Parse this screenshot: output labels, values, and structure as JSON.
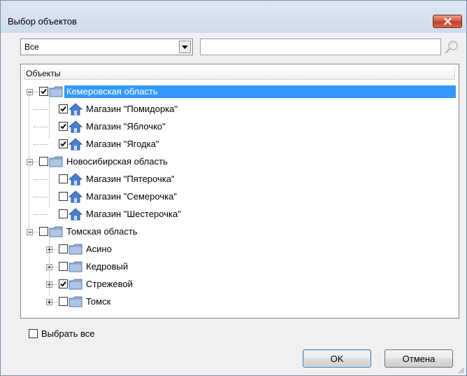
{
  "window": {
    "title": "Выбор объектов"
  },
  "filter": {
    "selected": "Все"
  },
  "search": {
    "value": "",
    "placeholder": ""
  },
  "tree": {
    "column_header": "Объекты",
    "nodes": [
      {
        "label": "Кемеровская область",
        "checked": true,
        "icon": "folder-icon",
        "expanded": true,
        "selected": true,
        "children": [
          {
            "label": "Магазин \"Помидорка\"",
            "checked": true,
            "icon": "house-icon"
          },
          {
            "label": "Магазин \"Яблочко\"",
            "checked": true,
            "icon": "house-icon"
          },
          {
            "label": "Магазин \"Ягодка\"",
            "checked": true,
            "icon": "house-icon"
          }
        ]
      },
      {
        "label": "Новосибирская область",
        "checked": false,
        "icon": "folder-icon",
        "expanded": true,
        "children": [
          {
            "label": "Магазин \"Пятерочка\"",
            "checked": false,
            "icon": "house-icon"
          },
          {
            "label": "Магазин \"Семерочка\"",
            "checked": false,
            "icon": "house-icon"
          },
          {
            "label": "Магазин \"Шестерочка\"",
            "checked": false,
            "icon": "house-icon"
          }
        ]
      },
      {
        "label": "Томская область",
        "checked": false,
        "icon": "folder-icon",
        "expanded": true,
        "children": [
          {
            "label": "Асино",
            "checked": false,
            "icon": "folder-icon",
            "collapsed": true
          },
          {
            "label": "Кедровый",
            "checked": false,
            "icon": "folder-icon",
            "collapsed": true
          },
          {
            "label": "Стрежевой",
            "checked": true,
            "icon": "folder-icon",
            "collapsed": true
          },
          {
            "label": "Томск",
            "checked": false,
            "icon": "folder-icon",
            "collapsed": true
          }
        ]
      }
    ]
  },
  "select_all": {
    "label": "Выбрать все",
    "checked": false
  },
  "buttons": {
    "ok": "OK",
    "cancel": "Отмена"
  },
  "colors": {
    "selection": "#3399ff",
    "title_gradient_top": "#dde7f3",
    "close_red": "#c33b26"
  }
}
